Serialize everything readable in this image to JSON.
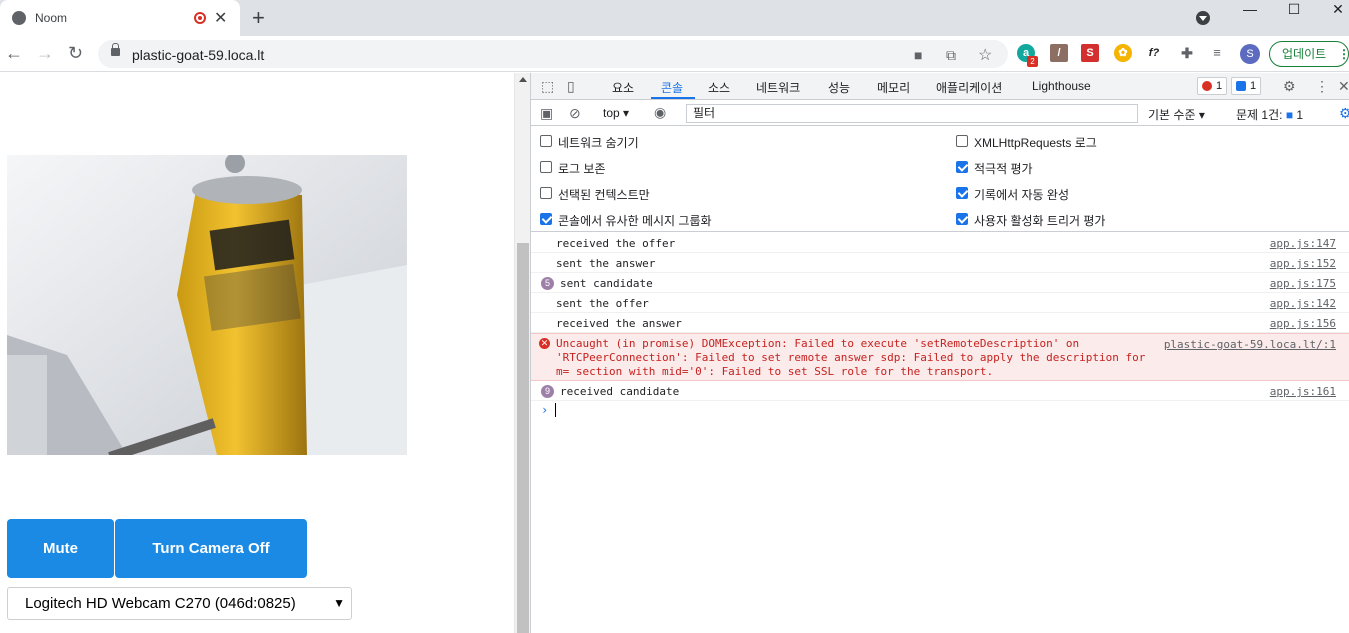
{
  "browser": {
    "tab_title": "Noom",
    "new_tab": "+",
    "close_tab": "✕",
    "url": "plastic-goat-59.loca.lt",
    "update_label": "업데이트",
    "avatar_initial": "S",
    "ext_badge_count": "2",
    "window_controls": {
      "minimize": "—",
      "maximize": "☐",
      "close": "✕"
    }
  },
  "page": {
    "mute_label": "Mute",
    "camera_label": "Turn Camera Off",
    "camera_select_value": "Logitech HD Webcam C270 (046d:0825)"
  },
  "devtools": {
    "tabs": [
      "요소",
      "콘솔",
      "소스",
      "네트워크",
      "성능",
      "메모리",
      "애플리케이션",
      "Lighthouse"
    ],
    "active_tab": "콘솔",
    "error_count": "1",
    "info_count": "1",
    "context": "top",
    "filter_placeholder": "필터",
    "log_level": "기본 수준",
    "issues_label": "문제 1건:",
    "issues_count": "1",
    "settings": [
      {
        "label": "네트워크 숨기기",
        "checked": false
      },
      {
        "label": "로그 보존",
        "checked": false
      },
      {
        "label": "선택된 컨텍스트만",
        "checked": false
      },
      {
        "label": "콘솔에서 유사한 메시지 그룹화",
        "checked": true
      },
      {
        "label": "XMLHttpRequests 로그",
        "checked": false
      },
      {
        "label": "적극적 평가",
        "checked": true
      },
      {
        "label": "기록에서 자동 완성",
        "checked": true
      },
      {
        "label": "사용자 활성화 트리거 평가",
        "checked": true
      }
    ],
    "console_rows": [
      {
        "message": "received the offer",
        "source": "app.js:147"
      },
      {
        "message": "sent the answer",
        "source": "app.js:152"
      },
      {
        "message": "sent candidate",
        "source": "app.js:175",
        "count": "5"
      },
      {
        "message": "sent the offer",
        "source": "app.js:142"
      },
      {
        "message": "received the answer",
        "source": "app.js:156"
      }
    ],
    "error_row": {
      "message": "Uncaught (in promise) DOMException: Failed to execute 'setRemoteDescription' on 'RTCPeerConnection': Failed to set remote answer sdp: Failed to apply the description for m= section with mid='0': Failed to set SSL role for the transport.",
      "source": "plastic-goat-59.loca.lt/:1"
    },
    "last_row": {
      "message": "received candidate",
      "source": "app.js:161",
      "count": "9"
    },
    "prompt_symbol": "›"
  }
}
